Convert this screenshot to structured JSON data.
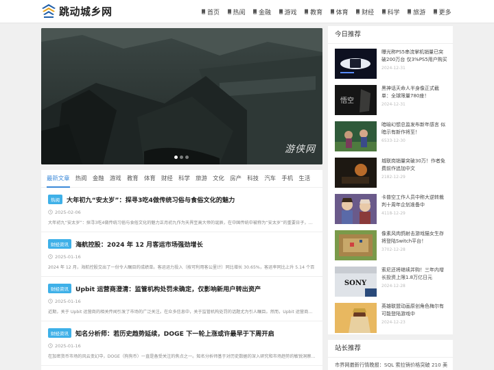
{
  "site": {
    "name": "跳动城乡网"
  },
  "nav": [
    {
      "label": "首页"
    },
    {
      "label": "热阅"
    },
    {
      "label": "金融"
    },
    {
      "label": "游戏"
    },
    {
      "label": "教育"
    },
    {
      "label": "体育"
    },
    {
      "label": "财经"
    },
    {
      "label": "科学"
    },
    {
      "label": "旅游"
    },
    {
      "label": "更多"
    }
  ],
  "slider": {
    "watermark": "游侠网",
    "dot_count": 3,
    "active_dot": 1
  },
  "tabs": [
    {
      "label": "最新文章"
    },
    {
      "label": "热阅"
    },
    {
      "label": "金融"
    },
    {
      "label": "游戏"
    },
    {
      "label": "教育"
    },
    {
      "label": "体育"
    },
    {
      "label": "财经"
    },
    {
      "label": "科学"
    },
    {
      "label": "旅游"
    },
    {
      "label": "文化"
    },
    {
      "label": "房产"
    },
    {
      "label": "科技"
    },
    {
      "label": "汽车"
    },
    {
      "label": "手机"
    },
    {
      "label": "生活"
    }
  ],
  "articles": [
    {
      "badge": "热阅",
      "title": "大年初九“安太岁”：探寻3吃4做传统习俗与食俗文化的魅力",
      "date": "2025-02-06",
      "desc": "大年初九“安太岁”：探寻3吃4做传统习俗与食俗文化的魅力正月初九作为天界至高大帝的诞辰，在中国传统中被称为“安太岁”的重要日子，人们..."
    },
    {
      "badge": "财经资讯",
      "title": "海航控股：2024 年 12 月客运市场强劲增长",
      "date": "2025-01-16",
      "desc": "2024 年 12 月，海航控股交出了一份令人瞩目的成绩单。客运运力投入（按可利用客公里计）同比增长 30.65%，客运率同比上升 5.14 个百"
    },
    {
      "badge": "财经资讯",
      "title": "Upbit 运营商澄清：监管机构处罚未确定，仅影响新用户转出资产",
      "date": "2025-01-16",
      "desc": "近期，关于 Upbit 运营商的相关传闻引发了市场的广泛关注。在众多信息中，关于监管机构处罚的话题尤为引人瞩目。然而，Upbit 运营商及时"
    },
    {
      "badge": "财经资讯",
      "title": "知名分析师：若历史趋势延续，DOGE 下一轮上涨或许最早于下周开启",
      "date": "2025-01-16",
      "desc": "在加密货币市场的风云变幻中，DOGE（狗狗币）一直是备受关注的焦点之一。知名分析师基于对历史数据的深入研究和市场趋势的敏锐洞察，提出了"
    }
  ],
  "sidebar": {
    "title": "今日推荐",
    "items": [
      {
        "title": "曝光称PS5串流掌机销量已突破200万台 仅3%PS5用户购买",
        "date": "2024-12-31",
        "thumb": "ps-portal"
      },
      {
        "title": "黑神话天命人半身像正式截单：全球限量780座！",
        "date": "2024-12-31",
        "thumb": "wukong"
      },
      {
        "title": "暗喻幻想总监发布新年感言 似暗示有新作将至！",
        "date": "6533-12-30",
        "thumb": "metaphor"
      },
      {
        "title": "城联岗销量突破30万！作者免费前作追加中文",
        "date": "2182-12-29",
        "thumb": "dark-game"
      },
      {
        "title": "卡普空工作人员中称大逆转裁判十周年企划准备中",
        "date": "4118-12-29",
        "thumb": "ace-attorney"
      },
      {
        "title": "像素风肉鸽射击游戏猫女生存将登陆Switch平台！",
        "date": "3702-12-28",
        "thumb": "pixel-game"
      },
      {
        "title": "索尼还将继续并购！三年内增长投资上限1.8万亿日元",
        "date": "2024-12-28",
        "thumb": "sony"
      },
      {
        "title": "英雄联盟动画原创角色梅尔有可能登陆游戏中",
        "date": "2024-12-23",
        "thumb": "mel"
      }
    ]
  },
  "sidebar2": {
    "title": "站长推荐",
    "line": "市界网最新行情晚报：SQL 索拉销价格突破 210 美"
  },
  "colors": {
    "accent": "#3a88d8",
    "badge": "#3eb0e8"
  }
}
